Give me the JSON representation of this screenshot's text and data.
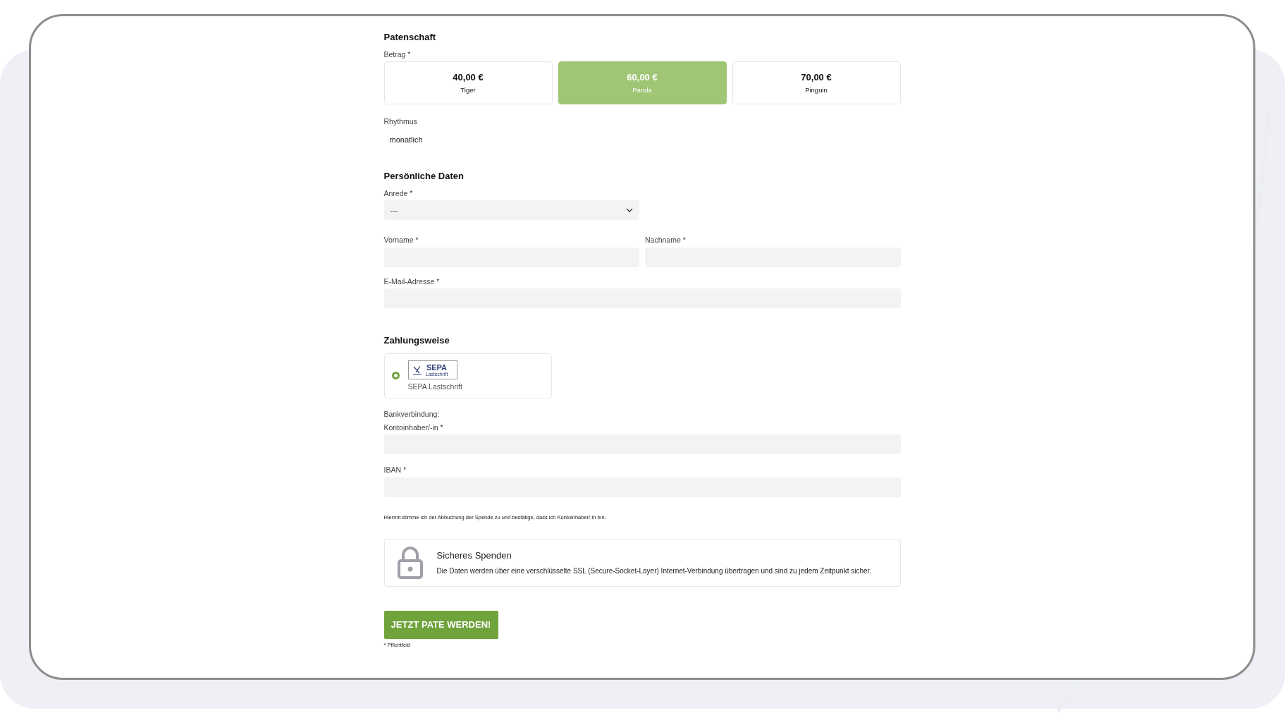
{
  "sponsorship": {
    "title": "Patenschaft",
    "amount_label": "Betrag *",
    "amounts": [
      {
        "amount": "40,00 €",
        "name": "Tiger",
        "selected": false
      },
      {
        "amount": "60,00 €",
        "name": "Panda",
        "selected": true
      },
      {
        "amount": "70,00 €",
        "name": "Pinguin",
        "selected": false
      }
    ],
    "rhythm_label": "Rhythmus",
    "rhythm_value": "monatlich"
  },
  "personal": {
    "title": "Persönliche Daten",
    "salutation": {
      "label": "Anrede *",
      "value": "---"
    },
    "first_name": {
      "label": "Vorname *"
    },
    "last_name": {
      "label": "Nachname *"
    },
    "email": {
      "label": "E-Mail-Adresse *"
    }
  },
  "payment": {
    "title": "Zahlungsweise",
    "methods": [
      {
        "logo_title": "SEPA",
        "logo_subtitle": "Lastschrift",
        "label": "SEPA Lastschrift",
        "selected": true
      }
    ],
    "bank_label": "Bankverbindung:",
    "account_holder": {
      "label": "Kontoinhaber/-in *"
    },
    "iban": {
      "label": "IBAN *"
    },
    "consent": "Hiermit stimme ich der Abbuchung der Spende zu und bestätige, dass ich Kontoinhaber/-in bin."
  },
  "security": {
    "title": "Sicheres Spenden",
    "text": "Die Daten werden über eine verschlüsselte SSL (Secure-Socket-Layer) Internet-Verbindung übertragen und sind zu jedem Zeitpunkt sicher."
  },
  "submit": "JETZT PATE WERDEN!",
  "required_note": "* Pflichtfeld"
}
